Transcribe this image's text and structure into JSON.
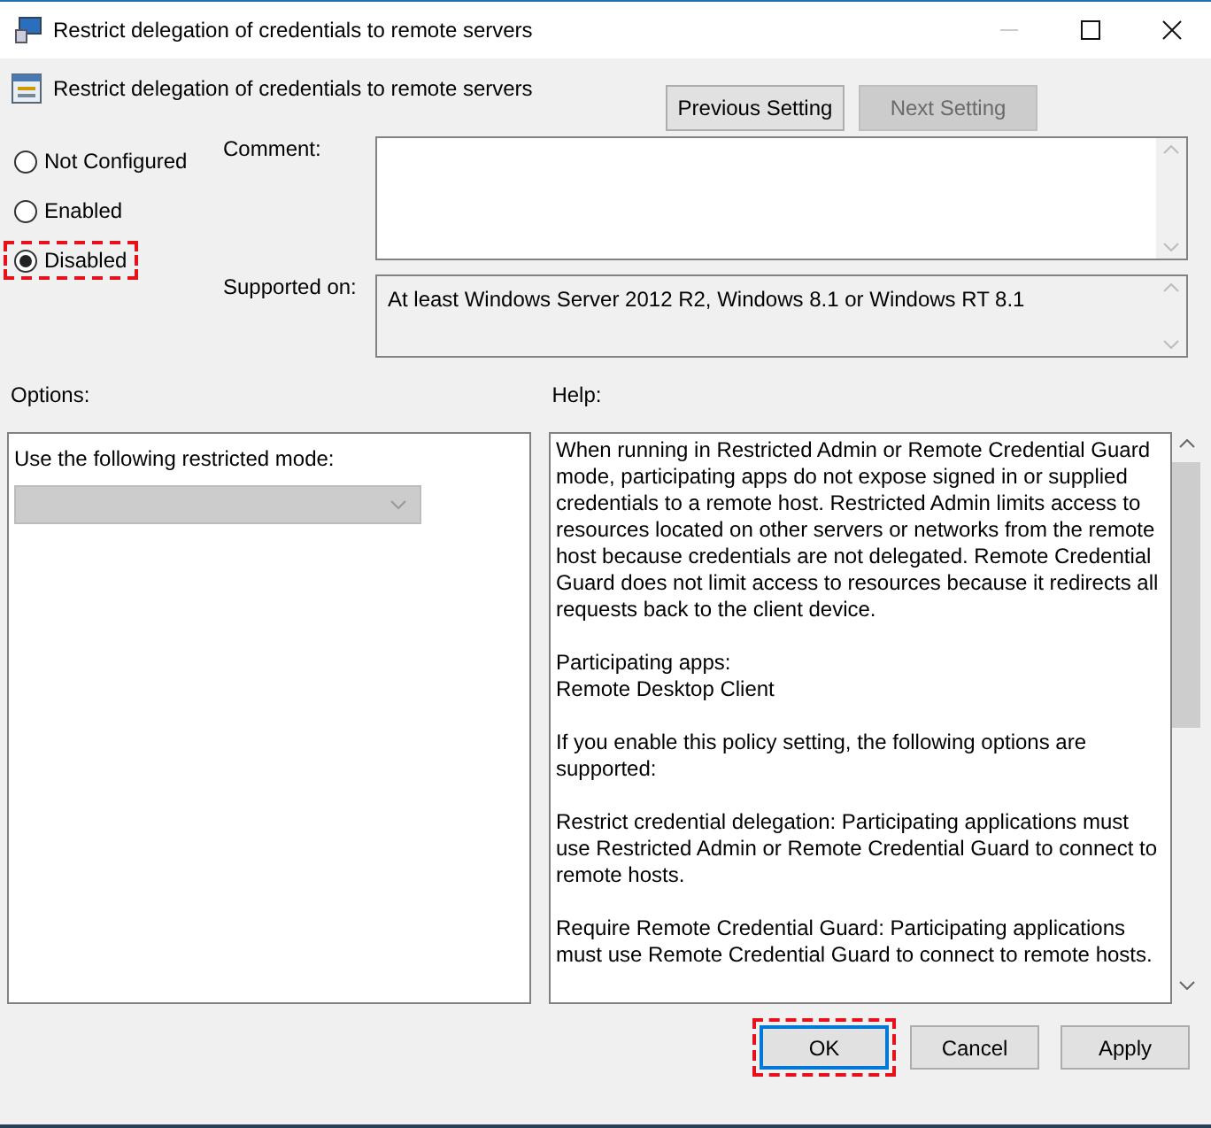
{
  "window": {
    "title": "Restrict delegation of credentials to remote servers"
  },
  "header": {
    "title": "Restrict delegation of credentials to remote servers",
    "buttons": [
      {
        "label": "Previous Setting",
        "disabled": false
      },
      {
        "label": "Next Setting",
        "disabled": true
      }
    ]
  },
  "state_options": [
    {
      "label": "Not Configured",
      "selected": false,
      "highlighted": false
    },
    {
      "label": "Enabled",
      "selected": false,
      "highlighted": false
    },
    {
      "label": "Disabled",
      "selected": true,
      "highlighted": true
    }
  ],
  "comment": {
    "label": "Comment:"
  },
  "supported_on": {
    "label": "Supported on:",
    "value": "At least Windows Server 2012 R2, Windows 8.1 or Windows RT 8.1"
  },
  "options": {
    "label": "Options:",
    "field_label": "Use the following restricted mode:",
    "dropdown_disabled": true
  },
  "help": {
    "label": "Help:",
    "paragraphs": [
      "When running in Restricted Admin or Remote Credential Guard mode, participating apps do not expose signed in or supplied credentials to a remote host. Restricted Admin limits access to resources located on other servers or networks from the remote host because credentials are not delegated. Remote Credential Guard does not limit access to resources because it redirects all requests back to the client device.",
      "Participating apps:\nRemote Desktop Client",
      "If you enable this policy setting, the following options are supported:",
      "Restrict credential delegation: Participating applications must use Restricted Admin or Remote Credential Guard to connect to remote hosts.",
      "Require Remote Credential Guard: Participating applications must use Remote Credential Guard to connect to remote hosts."
    ]
  },
  "buttons": [
    {
      "label": "OK",
      "default": true,
      "highlighted": true
    },
    {
      "label": "Cancel",
      "default": false,
      "highlighted": false
    },
    {
      "label": "Apply",
      "default": false,
      "highlighted": false
    }
  ]
}
